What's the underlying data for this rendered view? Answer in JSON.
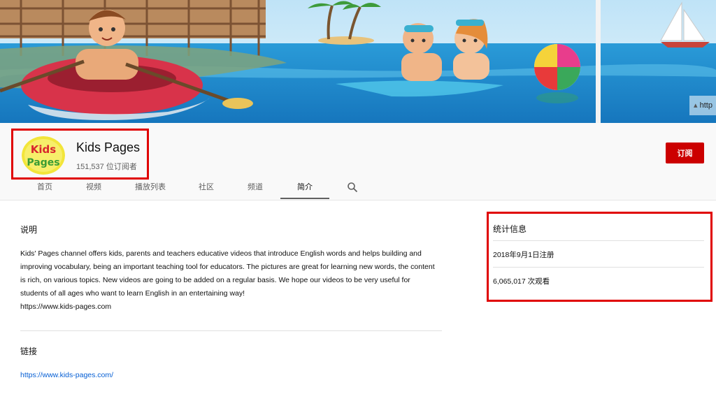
{
  "banner": {
    "link_text": "http"
  },
  "channel": {
    "name": "Kids Pages",
    "subscribers": "151,537 位订阅者",
    "avatar_text_line1": "Kids",
    "avatar_text_line2": "Pages",
    "subscribe_label": "订阅"
  },
  "tabs": [
    {
      "label": "首页"
    },
    {
      "label": "视频"
    },
    {
      "label": "播放列表"
    },
    {
      "label": "社区"
    },
    {
      "label": "频道"
    },
    {
      "label": "简介"
    }
  ],
  "about": {
    "description_title": "说明",
    "description_lines": [
      "Kids' Pages channel offers kids, parents and teachers educative videos that introduce English words and helps building and",
      "improving vocabulary, being an important teaching tool for educators. The pictures are great for learning new words, the content",
      "is rich, on various topics. New videos are going to be added on a regular basis. We hope our videos to be very useful for",
      "students of all ages who want to learn English in an entertaining way!",
      " https://www.kids-pages.com"
    ],
    "links_title": "链接",
    "link_url": "https://www.kids-pages.com/"
  },
  "stats": {
    "title": "统计信息",
    "joined": "2018年9月1日注册",
    "views": "6,065,017 次观看"
  },
  "colors": {
    "highlight": "#e00000",
    "subscribe": "#cc0000",
    "link": "#065fd4"
  }
}
